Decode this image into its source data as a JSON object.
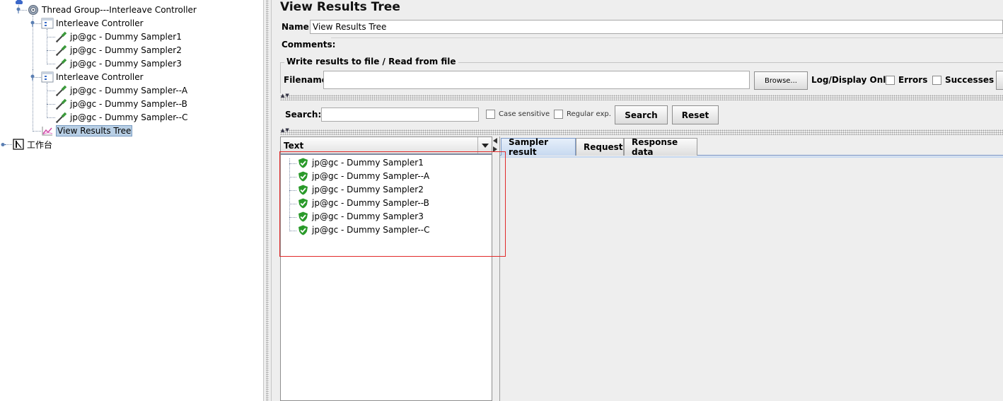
{
  "tree": {
    "thread_group": "Thread Group---Interleave Controller",
    "controller1": "Interleave Controller",
    "c1_samplers": [
      "jp@gc - Dummy Sampler1",
      "jp@gc - Dummy Sampler2",
      "jp@gc - Dummy Sampler3"
    ],
    "controller2": "Interleave Controller",
    "c2_samplers": [
      "jp@gc - Dummy Sampler--A",
      "jp@gc - Dummy Sampler--B",
      "jp@gc - Dummy Sampler--C"
    ],
    "listener": "View Results Tree",
    "workbench": "工作台"
  },
  "panel": {
    "title": "View Results Tree",
    "name_label": "Name:",
    "name_value": "View Results Tree",
    "comments_label": "Comments:",
    "write_legend": "Write results to file / Read from file",
    "filename_label": "Filename",
    "filename_value": "",
    "browse_label": "Browse...",
    "logdisplay_label": "Log/Display Only:",
    "errors_label": "Errors",
    "successes_label": "Successes"
  },
  "search": {
    "label": "Search:",
    "value": "",
    "case_sensitive": "Case sensitive",
    "regular_exp": "Regular exp.",
    "search_button": "Search",
    "reset_button": "Reset"
  },
  "results": {
    "header": "Text",
    "items": [
      "jp@gc - Dummy Sampler1",
      "jp@gc - Dummy Sampler--A",
      "jp@gc - Dummy Sampler2",
      "jp@gc - Dummy Sampler--B",
      "jp@gc - Dummy Sampler3",
      "jp@gc - Dummy Sampler--C"
    ]
  },
  "tabs": [
    "Sampler result",
    "Request",
    "Response data"
  ],
  "colors": {
    "selection": "#b8cfe5",
    "success_green": "#2a9a2a",
    "annotation_red": "#e12a2a"
  }
}
